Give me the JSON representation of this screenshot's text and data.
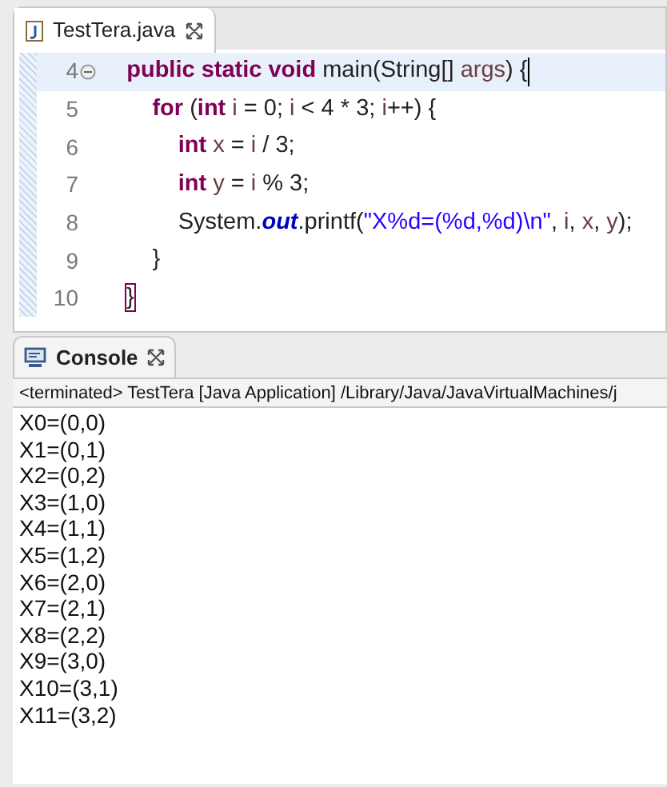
{
  "editor_tab": {
    "title": "TestTera.java"
  },
  "code_lines": [
    {
      "number": "4",
      "current": true,
      "foldable": true,
      "tokens": [
        {
          "kind": "keyword",
          "text": "    public static void"
        },
        {
          "kind": "plain",
          "text": " main(String[] "
        },
        {
          "kind": "local",
          "text": "args"
        },
        {
          "kind": "plain",
          "text": ") {"
        }
      ]
    },
    {
      "number": "5",
      "current": false,
      "foldable": false,
      "tokens": [
        {
          "kind": "keyword",
          "text": "        for"
        },
        {
          "kind": "plain",
          "text": " ("
        },
        {
          "kind": "keyword",
          "text": "int"
        },
        {
          "kind": "local",
          "text": " i"
        },
        {
          "kind": "plain",
          "text": " = 0; "
        },
        {
          "kind": "local",
          "text": "i"
        },
        {
          "kind": "plain",
          "text": " < 4 * 3; "
        },
        {
          "kind": "local",
          "text": "i"
        },
        {
          "kind": "plain",
          "text": "++) {"
        }
      ]
    },
    {
      "number": "6",
      "current": false,
      "foldable": false,
      "tokens": [
        {
          "kind": "keyword",
          "text": "            int"
        },
        {
          "kind": "local",
          "text": " x"
        },
        {
          "kind": "plain",
          "text": " = "
        },
        {
          "kind": "local",
          "text": "i"
        },
        {
          "kind": "plain",
          "text": " / 3;"
        }
      ]
    },
    {
      "number": "7",
      "current": false,
      "foldable": false,
      "tokens": [
        {
          "kind": "keyword",
          "text": "            int"
        },
        {
          "kind": "local",
          "text": " y"
        },
        {
          "kind": "plain",
          "text": " = "
        },
        {
          "kind": "local",
          "text": "i"
        },
        {
          "kind": "plain",
          "text": " % 3;"
        }
      ]
    },
    {
      "number": "8",
      "current": false,
      "foldable": false,
      "tokens": [
        {
          "kind": "plain",
          "text": "            System."
        },
        {
          "kind": "field",
          "text": "out"
        },
        {
          "kind": "plain",
          "text": ".printf("
        },
        {
          "kind": "string",
          "text": "\"X%d=(%d,%d)\\n\""
        },
        {
          "kind": "plain",
          "text": ", "
        },
        {
          "kind": "local",
          "text": "i"
        },
        {
          "kind": "plain",
          "text": ", "
        },
        {
          "kind": "local",
          "text": "x"
        },
        {
          "kind": "plain",
          "text": ", "
        },
        {
          "kind": "local",
          "text": "y"
        },
        {
          "kind": "plain",
          "text": ");"
        }
      ]
    },
    {
      "number": "9",
      "current": false,
      "foldable": false,
      "tokens": [
        {
          "kind": "plain",
          "text": "        }"
        }
      ]
    },
    {
      "number": "10",
      "current": false,
      "foldable": false,
      "tokens": [
        {
          "kind": "bracket",
          "text": "}"
        }
      ]
    }
  ],
  "console_tab": {
    "title": "Console"
  },
  "console": {
    "header": "<terminated> TestTera [Java Application] /Library/Java/JavaVirtualMachines/j",
    "output": [
      "X0=(0,0)",
      "X1=(0,1)",
      "X2=(0,2)",
      "X3=(1,0)",
      "X4=(1,1)",
      "X5=(1,2)",
      "X6=(2,0)",
      "X7=(2,1)",
      "X8=(2,2)",
      "X9=(3,0)",
      "X10=(3,1)",
      "X11=(3,2)"
    ]
  }
}
